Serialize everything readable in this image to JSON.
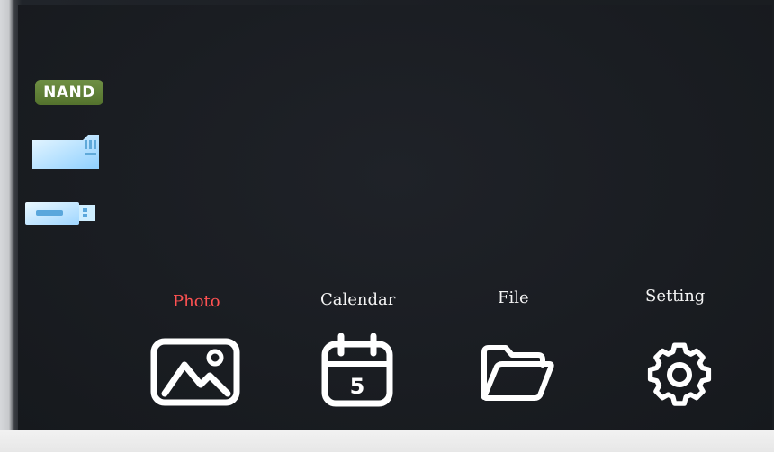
{
  "storage": {
    "nand_label": "NAND",
    "sd_icon": "sd-card-icon",
    "usb_icon": "usb-drive-icon"
  },
  "menu": {
    "items": [
      {
        "label": "Photo",
        "icon": "photo-icon",
        "selected": true
      },
      {
        "label": "Calendar",
        "icon": "calendar-icon",
        "selected": false,
        "day": "5"
      },
      {
        "label": "File",
        "icon": "folder-icon",
        "selected": false
      },
      {
        "label": "Setting",
        "icon": "gear-icon",
        "selected": false
      }
    ]
  },
  "colors": {
    "selected_label": "#ff5252",
    "label": "#f4f4f4",
    "nand_badge": "#5f7f37",
    "storage_icons": "#b9e3ff"
  }
}
